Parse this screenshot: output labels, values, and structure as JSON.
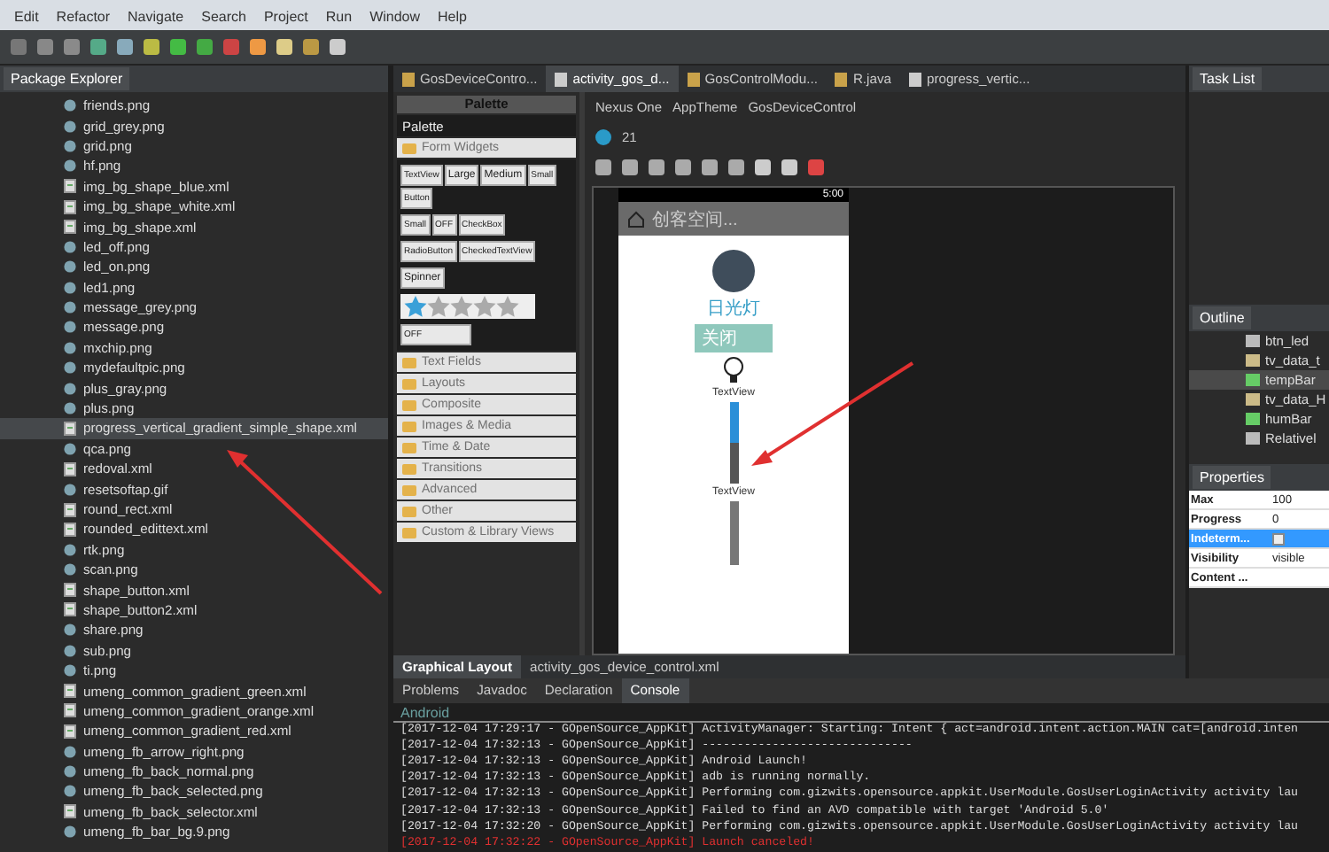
{
  "menu": [
    "Edit",
    "Refactor",
    "Navigate",
    "Search",
    "Project",
    "Run",
    "Window",
    "Help"
  ],
  "package_explorer": {
    "title": "Package Explorer",
    "items": [
      {
        "name": "friends.png",
        "kind": "image",
        "selected": false
      },
      {
        "name": "grid_grey.png",
        "kind": "image",
        "selected": false
      },
      {
        "name": "grid.png",
        "kind": "image",
        "selected": false
      },
      {
        "name": "hf.png",
        "kind": "image",
        "selected": false
      },
      {
        "name": "img_bg_shape_blue.xml",
        "kind": "xml",
        "selected": false
      },
      {
        "name": "img_bg_shape_white.xml",
        "kind": "xml",
        "selected": false
      },
      {
        "name": "img_bg_shape.xml",
        "kind": "xml",
        "selected": false
      },
      {
        "name": "led_off.png",
        "kind": "image",
        "selected": false
      },
      {
        "name": "led_on.png",
        "kind": "image",
        "selected": false
      },
      {
        "name": "led1.png",
        "kind": "image",
        "selected": false
      },
      {
        "name": "message_grey.png",
        "kind": "image",
        "selected": false
      },
      {
        "name": "message.png",
        "kind": "image",
        "selected": false
      },
      {
        "name": "mxchip.png",
        "kind": "image",
        "selected": false
      },
      {
        "name": "mydefaultpic.png",
        "kind": "image",
        "selected": false
      },
      {
        "name": "plus_gray.png",
        "kind": "image",
        "selected": false
      },
      {
        "name": "plus.png",
        "kind": "image",
        "selected": false
      },
      {
        "name": "progress_vertical_gradient_simple_shape.xml",
        "kind": "xml",
        "selected": true
      },
      {
        "name": "qca.png",
        "kind": "image",
        "selected": false
      },
      {
        "name": "redoval.xml",
        "kind": "xml",
        "selected": false
      },
      {
        "name": "resetsoftap.gif",
        "kind": "image",
        "selected": false
      },
      {
        "name": "round_rect.xml",
        "kind": "xml",
        "selected": false
      },
      {
        "name": "rounded_edittext.xml",
        "kind": "xml",
        "selected": false
      },
      {
        "name": "rtk.png",
        "kind": "image",
        "selected": false
      },
      {
        "name": "scan.png",
        "kind": "image",
        "selected": false
      },
      {
        "name": "shape_button.xml",
        "kind": "xml",
        "selected": false
      },
      {
        "name": "shape_button2.xml",
        "kind": "xml",
        "selected": false
      },
      {
        "name": "share.png",
        "kind": "image",
        "selected": false
      },
      {
        "name": "sub.png",
        "kind": "image",
        "selected": false
      },
      {
        "name": "ti.png",
        "kind": "image",
        "selected": false
      },
      {
        "name": "umeng_common_gradient_green.xml",
        "kind": "xml",
        "selected": false
      },
      {
        "name": "umeng_common_gradient_orange.xml",
        "kind": "xml",
        "selected": false
      },
      {
        "name": "umeng_common_gradient_red.xml",
        "kind": "xml",
        "selected": false
      },
      {
        "name": "umeng_fb_arrow_right.png",
        "kind": "image",
        "selected": false
      },
      {
        "name": "umeng_fb_back_normal.png",
        "kind": "image",
        "selected": false
      },
      {
        "name": "umeng_fb_back_selected.png",
        "kind": "image",
        "selected": false
      },
      {
        "name": "umeng_fb_back_selector.xml",
        "kind": "xml",
        "selected": false
      },
      {
        "name": "umeng_fb_bar_bg.9.png",
        "kind": "image",
        "selected": false
      }
    ]
  },
  "editor_tabs": [
    {
      "label": "GosDeviceContro...",
      "kind": "java",
      "selected": false
    },
    {
      "label": "activity_gos_d...",
      "kind": "xml",
      "selected": true
    },
    {
      "label": "GosControlModu...",
      "kind": "java",
      "selected": false
    },
    {
      "label": "R.java",
      "kind": "java",
      "selected": false
    },
    {
      "label": "progress_vertic...",
      "kind": "xml",
      "selected": false
    }
  ],
  "palette": {
    "title": "Palette",
    "dropdown": "Palette",
    "open_category": "Form Widgets",
    "widget_rows": [
      [
        "TextView",
        "Large",
        "Medium",
        "Small",
        "Button"
      ],
      [
        "Small",
        "OFF",
        "CheckBox"
      ],
      [
        "RadioButton",
        "CheckedTextView"
      ],
      [
        "Spinner"
      ]
    ],
    "rating": {
      "stars": 1
    },
    "switch_label": "OFF",
    "categories": [
      "Text Fields",
      "Layouts",
      "Composite",
      "Images & Media",
      "Time & Date",
      "Transitions",
      "Advanced",
      "Other",
      "Custom & Library Views"
    ]
  },
  "layout_toolbar": {
    "device": "Nexus One",
    "theme": "AppTheme",
    "activity": "GosDeviceControl",
    "api": "21"
  },
  "phone": {
    "time": "5:00",
    "title": "创客空间...",
    "lamp_label": "日光灯",
    "switch_button": "关闭",
    "labels": [
      "TextView",
      "TextView"
    ],
    "progress": {
      "level": 0.5
    }
  },
  "editor_bottom_tabs": [
    {
      "label": "Graphical Layout",
      "selected": true
    },
    {
      "label": "activity_gos_device_control.xml",
      "selected": false
    }
  ],
  "task_list": {
    "title": "Task List"
  },
  "outline": {
    "title": "Outline",
    "items": [
      {
        "name": "btn_led",
        "kind": "button",
        "selected": false
      },
      {
        "name": "tv_data_t",
        "kind": "text",
        "selected": false
      },
      {
        "name": "tempBar",
        "kind": "bar",
        "selected": true
      },
      {
        "name": "tv_data_H",
        "kind": "text",
        "selected": false
      },
      {
        "name": "humBar",
        "kind": "bar",
        "selected": false
      },
      {
        "name": "Relativel",
        "kind": "layout",
        "selected": false
      }
    ]
  },
  "properties": {
    "title": "Properties",
    "rows": [
      {
        "name": "Max",
        "value": "100",
        "selected": false
      },
      {
        "name": "Progress",
        "value": "0",
        "selected": false
      },
      {
        "name": "Indeterm...",
        "kind": "checkbox",
        "checked": false,
        "selected": true
      },
      {
        "name": "Visibility",
        "value": "visible",
        "selected": false
      },
      {
        "name": "Content ...",
        "value": "",
        "selected": false
      }
    ]
  },
  "console_tabs": [
    {
      "label": "Problems",
      "selected": false
    },
    {
      "label": "Javadoc",
      "selected": false
    },
    {
      "label": "Declaration",
      "selected": false
    },
    {
      "label": "Console",
      "selected": true
    }
  ],
  "console": {
    "name": "Android",
    "lines": [
      {
        "text": "[2017-12-04 17:29:17 - GOpenSource_AppKit] ActivityManager: Starting: Intent { act=android.intent.action.MAIN cat=[android.inten",
        "error": false
      },
      {
        "text": "[2017-12-04 17:32:13 - GOpenSource_AppKit] ------------------------------",
        "error": false
      },
      {
        "text": "[2017-12-04 17:32:13 - GOpenSource_AppKit] Android Launch!",
        "error": false
      },
      {
        "text": "[2017-12-04 17:32:13 - GOpenSource_AppKit] adb is running normally.",
        "error": false
      },
      {
        "text": "[2017-12-04 17:32:13 - GOpenSource_AppKit] Performing com.gizwits.opensource.appkit.UserModule.GosUserLoginActivity activity lau",
        "error": false
      },
      {
        "text": "[2017-12-04 17:32:13 - GOpenSource_AppKit] Failed to find an AVD compatible with target 'Android 5.0'",
        "error": false
      },
      {
        "text": "[2017-12-04 17:32:20 - GOpenSource_AppKit] Performing com.gizwits.opensource.appkit.UserModule.GosUserLoginActivity activity lau",
        "error": false
      },
      {
        "text": "[2017-12-04 17:32:22 - GOpenSource_AppKit] Launch canceled!",
        "error": true
      }
    ]
  }
}
